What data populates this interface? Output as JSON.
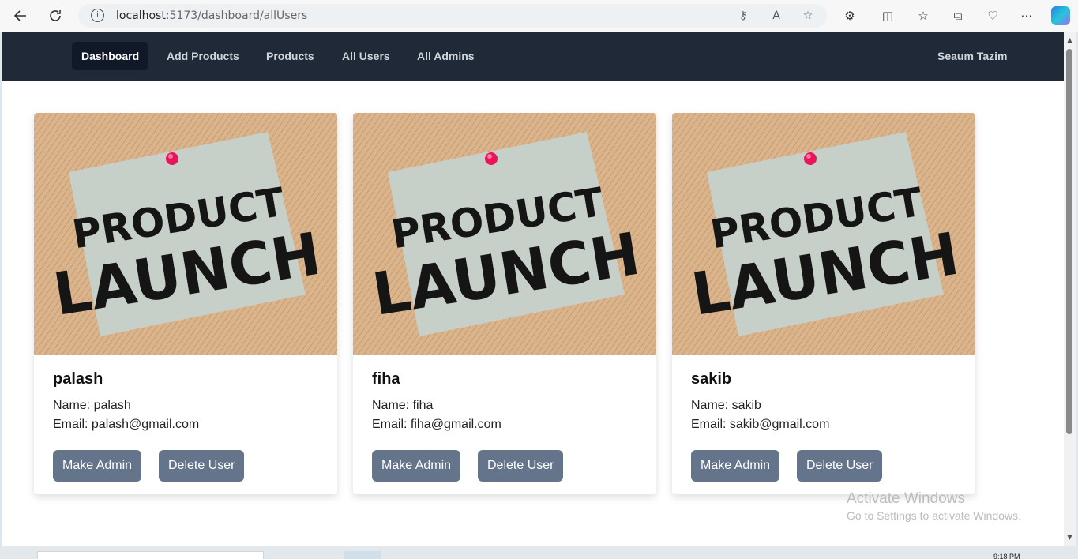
{
  "browser": {
    "url_host": "localhost",
    "url_path": ":5173/dashboard/allUsers"
  },
  "navbar": {
    "items": [
      {
        "label": "Dashboard"
      },
      {
        "label": "Add Products"
      },
      {
        "label": "Products"
      },
      {
        "label": "All Users"
      },
      {
        "label": "All Admins"
      }
    ],
    "active": "Dashboard",
    "user_name": "Seaum Tazim"
  },
  "users": [
    {
      "username": "palash",
      "name_line": "Name: palash",
      "email_line": "Email: palash@gmail.com",
      "make_admin": "Make Admin",
      "delete": "Delete User"
    },
    {
      "username": "fiha",
      "name_line": "Name: fiha",
      "email_line": "Email: fiha@gmail.com",
      "make_admin": "Make Admin",
      "delete": "Delete User"
    },
    {
      "username": "sakib",
      "name_line": "Name: sakib",
      "email_line": "Email: sakib@gmail.com",
      "make_admin": "Make Admin",
      "delete": "Delete User"
    }
  ],
  "card_image": {
    "line1": "PRODUCT",
    "line2": "LAUNCH"
  },
  "watermark": {
    "title": "Activate Windows",
    "subtitle": "Go to Settings to activate Windows."
  },
  "taskbar": {
    "time": "9:18 PM"
  },
  "colors": {
    "navbar_bg": "#1f2937",
    "button_bg": "#64748b",
    "active_nav_bg": "#111827"
  }
}
